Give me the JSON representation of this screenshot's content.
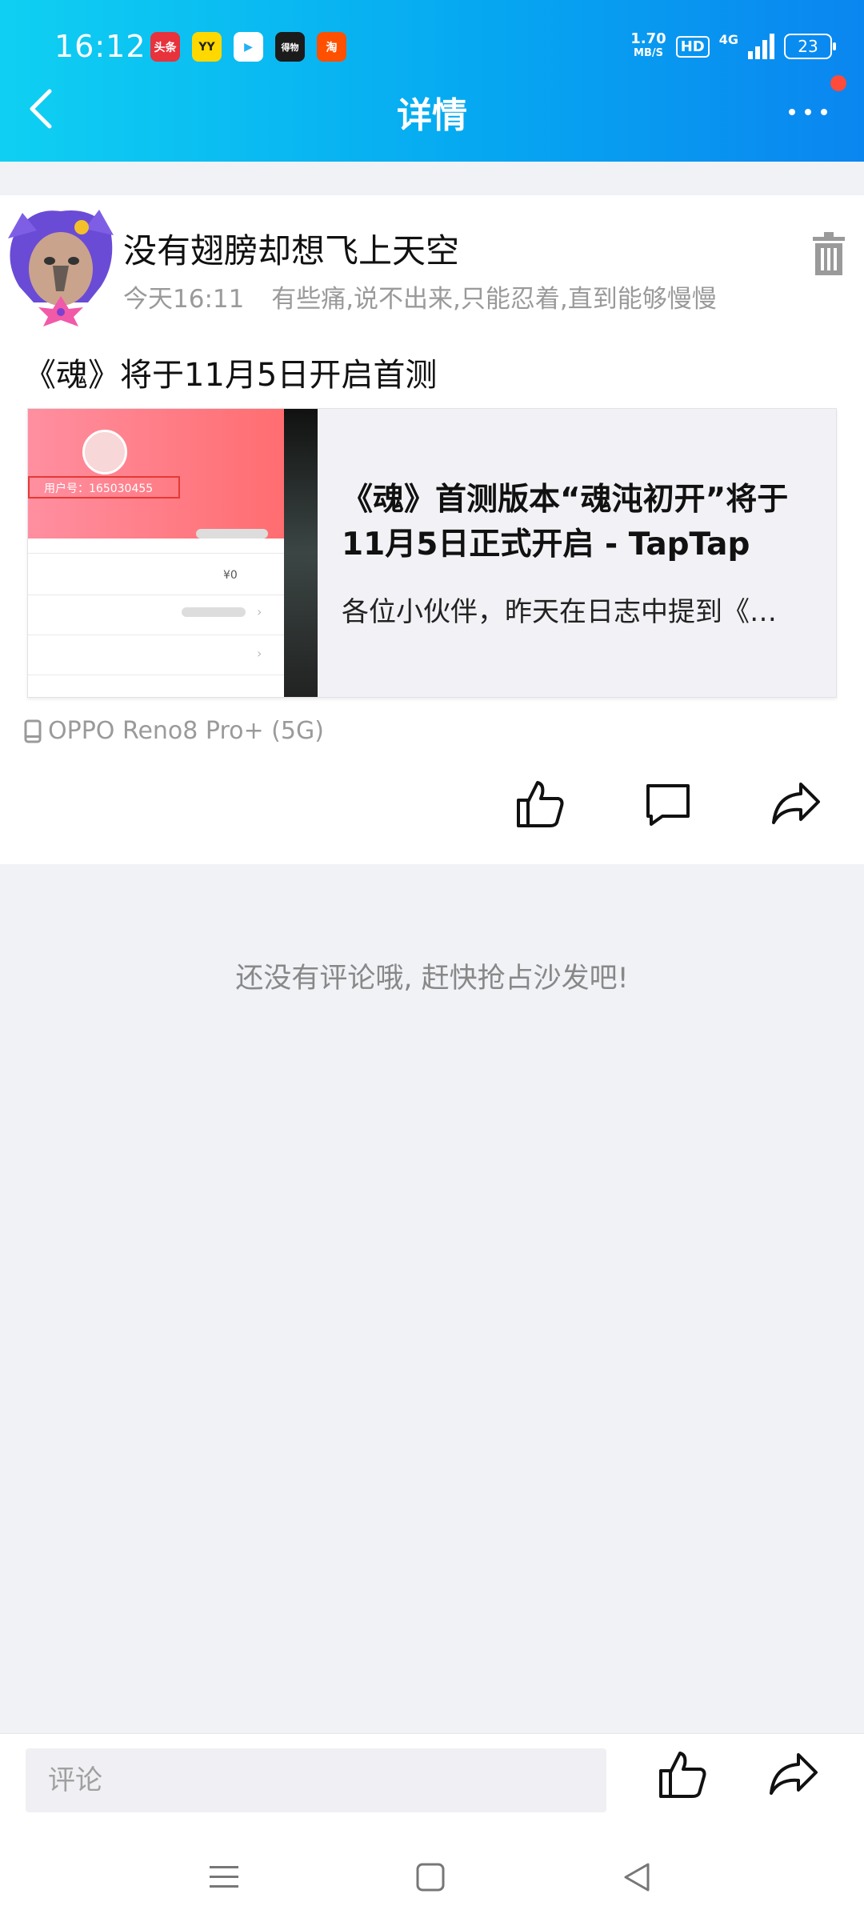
{
  "status_bar": {
    "time": "16:12",
    "app_icons": [
      {
        "name": "toutiao-icon",
        "label": "头条",
        "color": "#e8323c"
      },
      {
        "name": "yy-icon",
        "label": "YY",
        "color": "#ffd800"
      },
      {
        "name": "tencent-video-icon",
        "label": "▶",
        "color": "#ffffff"
      },
      {
        "name": "dewu-icon",
        "label": "得物",
        "color": "#1b1b1b"
      },
      {
        "name": "taobao-icon",
        "label": "淘",
        "color": "#ff5000"
      }
    ],
    "net_speed_value": "1.70",
    "net_speed_unit": "MB/S",
    "hd_label": "HD",
    "network_label": "4G",
    "battery": "23"
  },
  "header": {
    "title": "详情",
    "accent_color": "#06a8f1"
  },
  "post": {
    "username": "没有翅膀却想飞上天空",
    "timestamp": "今天16:11",
    "signature": "有些痛,说不出来,只能忍着,直到能够慢慢",
    "text": "《魂》将于11月5日开启首测",
    "link": {
      "title": "《魂》首测版本“魂沌初开”将于11月5日正式开启 - TapTap",
      "description": "各位小伙伴，昨天在日志中提到《…",
      "thumb_user_id": "用户号：165030455",
      "thumb_amount": "¥0"
    },
    "device": "OPPO Reno8 Pro+ (5G)"
  },
  "comments": {
    "empty_text": "还没有评论哦, 赶快抢占沙发吧!"
  },
  "bottom_bar": {
    "comment_placeholder": "评论"
  }
}
